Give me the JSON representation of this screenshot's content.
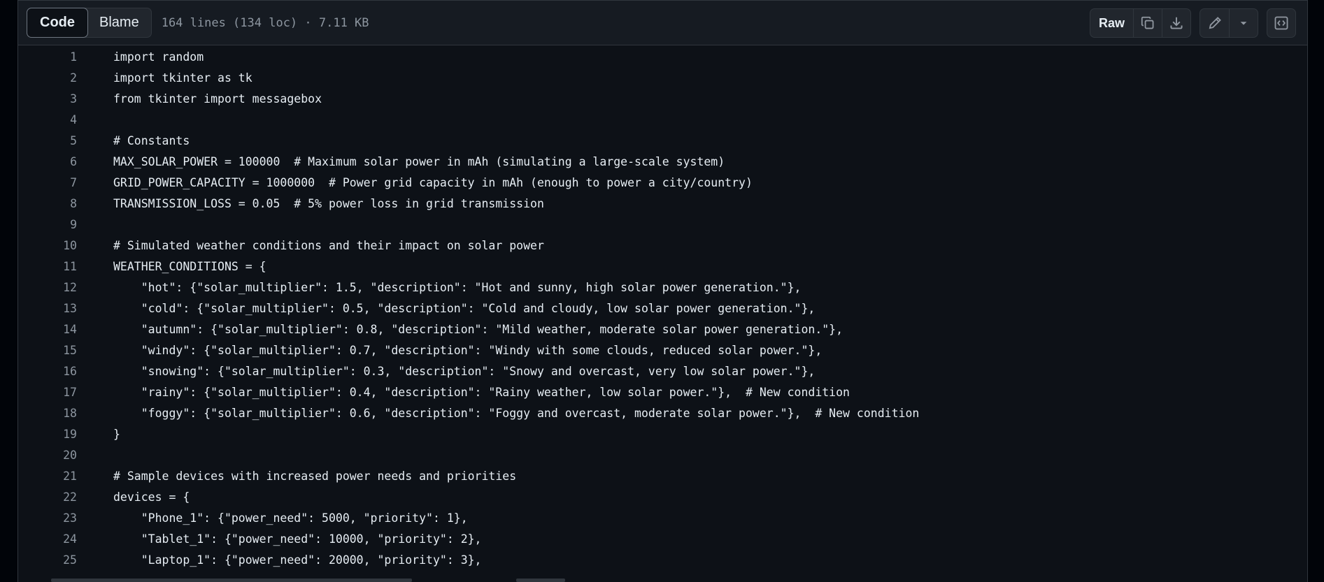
{
  "tabs": {
    "code": "Code",
    "blame": "Blame"
  },
  "file_info": "164 lines (134 loc) · 7.11 KB",
  "toolbar": {
    "raw": "Raw"
  },
  "icons": {
    "copy": "copy-icon",
    "download": "download-icon",
    "edit": "pencil-icon",
    "more": "triangle-down-icon",
    "symbols": "code-square-icon"
  },
  "colors": {
    "bg": "#0d1117",
    "header": "#161b22",
    "border": "#30363d",
    "muted": "#8d96a0",
    "text": "#e6edf3"
  },
  "lines": [
    {
      "n": "1",
      "t": "import random"
    },
    {
      "n": "2",
      "t": "import tkinter as tk"
    },
    {
      "n": "3",
      "t": "from tkinter import messagebox"
    },
    {
      "n": "4",
      "t": ""
    },
    {
      "n": "5",
      "t": "# Constants"
    },
    {
      "n": "6",
      "t": "MAX_SOLAR_POWER = 100000  # Maximum solar power in mAh (simulating a large-scale system)"
    },
    {
      "n": "7",
      "t": "GRID_POWER_CAPACITY = 1000000  # Power grid capacity in mAh (enough to power a city/country)"
    },
    {
      "n": "8",
      "t": "TRANSMISSION_LOSS = 0.05  # 5% power loss in grid transmission"
    },
    {
      "n": "9",
      "t": ""
    },
    {
      "n": "10",
      "t": "# Simulated weather conditions and their impact on solar power"
    },
    {
      "n": "11",
      "t": "WEATHER_CONDITIONS = {"
    },
    {
      "n": "12",
      "t": "    \"hot\": {\"solar_multiplier\": 1.5, \"description\": \"Hot and sunny, high solar power generation.\"},"
    },
    {
      "n": "13",
      "t": "    \"cold\": {\"solar_multiplier\": 0.5, \"description\": \"Cold and cloudy, low solar power generation.\"},"
    },
    {
      "n": "14",
      "t": "    \"autumn\": {\"solar_multiplier\": 0.8, \"description\": \"Mild weather, moderate solar power generation.\"},"
    },
    {
      "n": "15",
      "t": "    \"windy\": {\"solar_multiplier\": 0.7, \"description\": \"Windy with some clouds, reduced solar power.\"},"
    },
    {
      "n": "16",
      "t": "    \"snowing\": {\"solar_multiplier\": 0.3, \"description\": \"Snowy and overcast, very low solar power.\"},"
    },
    {
      "n": "17",
      "t": "    \"rainy\": {\"solar_multiplier\": 0.4, \"description\": \"Rainy weather, low solar power.\"},  # New condition"
    },
    {
      "n": "18",
      "t": "    \"foggy\": {\"solar_multiplier\": 0.6, \"description\": \"Foggy and overcast, moderate solar power.\"},  # New condition"
    },
    {
      "n": "19",
      "t": "}"
    },
    {
      "n": "20",
      "t": ""
    },
    {
      "n": "21",
      "t": "# Sample devices with increased power needs and priorities"
    },
    {
      "n": "22",
      "t": "devices = {"
    },
    {
      "n": "23",
      "t": "    \"Phone_1\": {\"power_need\": 5000, \"priority\": 1},"
    },
    {
      "n": "24",
      "t": "    \"Tablet_1\": {\"power_need\": 10000, \"priority\": 2},"
    },
    {
      "n": "25",
      "t": "    \"Laptop_1\": {\"power_need\": 20000, \"priority\": 3},"
    }
  ]
}
